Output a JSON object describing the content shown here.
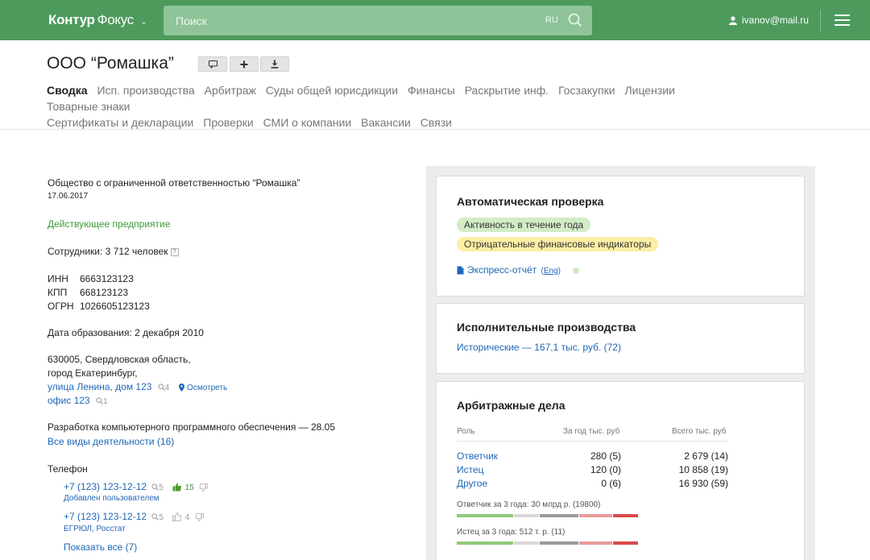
{
  "header": {
    "logo_part1": "Контур",
    "logo_part2": "Фокус",
    "search_placeholder": "Поиск",
    "lang": "RU",
    "user_email": "ivanov@mail.ru"
  },
  "company": {
    "title": "ООО “Ромашка”",
    "tabs": [
      "Сводка",
      "Исп. производства",
      "Арбитраж",
      "Суды общей юрисдикции",
      "Финансы",
      "Раскрытие инф.",
      "Госзакупки",
      "Лицензии",
      "Товарные знаки",
      "Сертификаты и декларации",
      "Проверки",
      "СМИ о компании",
      "Вакансии",
      "Связи"
    ],
    "full_name": "Общество с ограниченной ответственностью “Ромашка”",
    "date": "17.06.2017",
    "status": "Действующее предприятие",
    "employees": "Сотрудники: 3 712 человек",
    "inn_label": "ИНН",
    "inn": "6663123123",
    "kpp_label": "КПП",
    "kpp": "668123123",
    "ogrn_label": "ОГРН",
    "ogrn": "1026605123123",
    "founded": "Дата образования: 2 декабря 2010",
    "address_line1": "630005, Свердловская область,",
    "address_line2": "город Екатеринбург,",
    "street": "улица Ленина, дом 123",
    "street_count": "4",
    "inspect": "Осмотреть",
    "office": "офис 123",
    "office_count": "1",
    "activity": "Разработка компьютерного программного обеспечения — 28.05",
    "all_activities": "Все виды деятельности (16)",
    "phone_label": "Телефон",
    "phones": [
      {
        "number": "+7 (123) 123-12-12",
        "searches": "5",
        "likes": "15",
        "source": "Добавлен пользователем"
      },
      {
        "number": "+7 (123) 123-12-12",
        "searches": "5",
        "likes": "4",
        "source": "ЕГРЮЛ, Росстат"
      }
    ],
    "show_all": "Показать все (7)"
  },
  "auto_check": {
    "title": "Автоматическая проверка",
    "badge_green": "Активность в течение года",
    "badge_yellow": "Отрицательные финансовые индикаторы",
    "express": "Экспресс-отчёт",
    "eng": "Eng"
  },
  "enforcement": {
    "title": "Исполнительные производства",
    "historical": "Исторические — 167,1 тыс. руб. (72)"
  },
  "arbitration": {
    "title": "Арбитражные дела",
    "col_role": "Роль",
    "col_year": "За год тыс. руб",
    "col_total": "Всего тыс. руб",
    "rows": [
      {
        "role": "Ответчик",
        "year": "280 (5)",
        "total": "2 679 (14)"
      },
      {
        "role": "Истец",
        "year": "120 (0)",
        "total": "10 858 (19)"
      },
      {
        "role": "Другое",
        "year": "0 (6)",
        "total": "16 930 (59)"
      }
    ],
    "defendant_3y": "Ответчик за 3 года: 30 млрд р. (19800)",
    "plaintiff_3y": "Истец за 3 года: 512 т. р. (11)",
    "colors": {
      "green": "#8fc97a",
      "lightgray": "#d8d8d8",
      "gray": "#9a9a9a",
      "pink": "#e99a9a",
      "red": "#d94b4b"
    }
  }
}
